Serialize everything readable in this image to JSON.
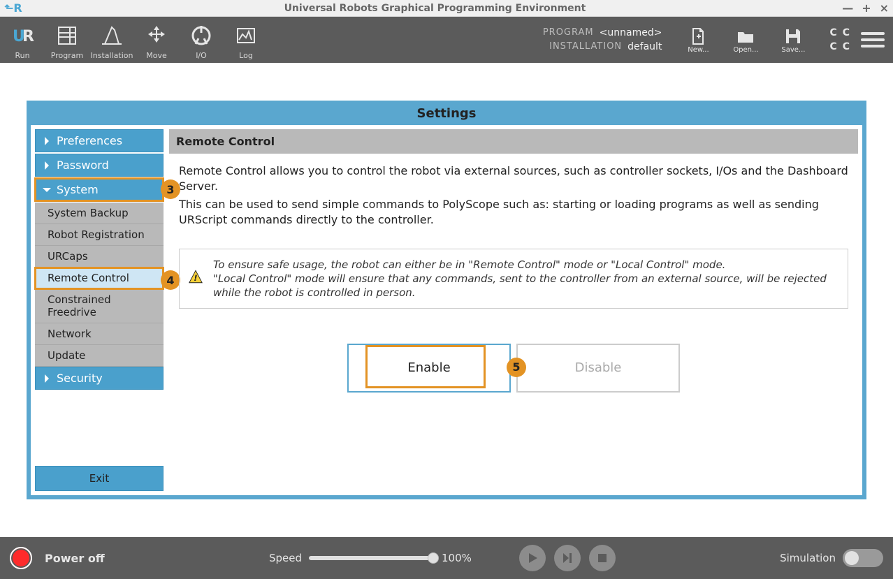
{
  "os": {
    "title": "Universal Robots Graphical Programming Environment"
  },
  "toolbar": {
    "items": [
      "Run",
      "Program",
      "Installation",
      "Move",
      "I/O",
      "Log"
    ],
    "meta": {
      "program_label": "PROGRAM",
      "program_value": "<unnamed>",
      "install_label": "INSTALLATION",
      "install_value": "default"
    },
    "files": {
      "new": "New...",
      "open": "Open...",
      "save": "Save..."
    }
  },
  "settings": {
    "title": "Settings",
    "sidebar": {
      "preferences": "Preferences",
      "password": "Password",
      "system": "System",
      "system_items": [
        "System Backup",
        "Robot Registration",
        "URCaps",
        "Remote Control",
        "Constrained Freedrive",
        "Network",
        "Update"
      ],
      "security": "Security",
      "exit": "Exit"
    },
    "content": {
      "header": "Remote Control",
      "p1": "Remote Control allows you to control the robot via external sources, such as controller sockets, I/Os and the Dashboard Server.",
      "p2": "This can be used to send simple commands to PolyScope such as: starting or loading programs as well as sending URScript commands directly to the controller.",
      "info1": "To ensure safe usage, the robot can either be in \"Remote Control\" mode or \"Local Control\" mode.",
      "info2": "\"Local Control\" mode will ensure that any commands, sent to the controller from an external source, will be rejected while the robot is controlled in person.",
      "enable": "Enable",
      "disable": "Disable"
    }
  },
  "callouts": {
    "c3": "3",
    "c4": "4",
    "c5": "5"
  },
  "bottom": {
    "power": "Power off",
    "speed_label": "Speed",
    "speed_value": "100%",
    "simulation": "Simulation"
  }
}
